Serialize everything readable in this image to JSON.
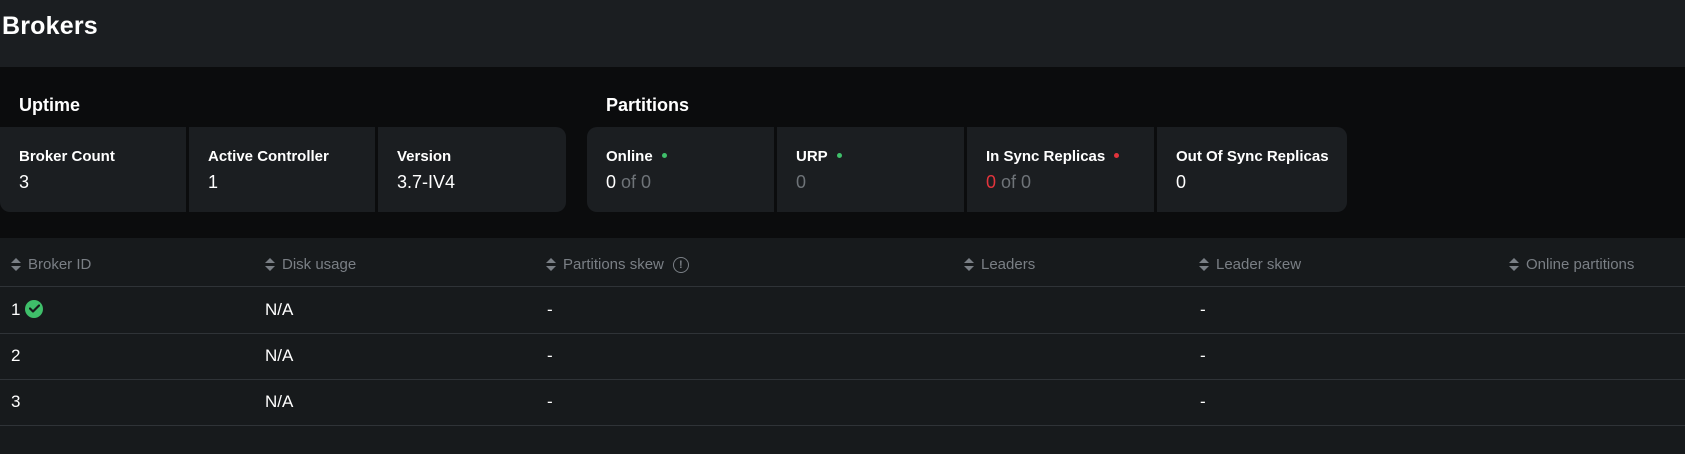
{
  "page": {
    "title": "Brokers"
  },
  "uptime": {
    "title": "Uptime",
    "cards": [
      {
        "label": "Broker Count",
        "value": "3"
      },
      {
        "label": "Active Controller",
        "value": "1"
      },
      {
        "label": "Version",
        "value": "3.7-IV4"
      }
    ]
  },
  "partitions": {
    "title": "Partitions",
    "online": {
      "label": "Online",
      "value": "0",
      "of": "of 0",
      "status_color": "#3fbf6a"
    },
    "urp": {
      "label": "URP",
      "value": "0",
      "status_color": "#3fbf6a"
    },
    "in_sync": {
      "label": "In Sync Replicas",
      "value": "0",
      "of": "of 0",
      "status_color": "#e2343c"
    },
    "out_of_sync": {
      "label": "Out Of Sync Replicas",
      "value": "0"
    }
  },
  "table": {
    "columns": [
      "Broker ID",
      "Disk usage",
      "Partitions skew",
      "Leaders",
      "Leader skew",
      "Online partitions"
    ],
    "partitions_skew_info_icon": "info-icon",
    "rows": [
      {
        "broker_id": "1",
        "is_controller": true,
        "controller_icon": "check-circle-icon",
        "disk_usage": "N/A",
        "partitions_skew": "-",
        "leaders": "",
        "leader_skew": "-",
        "online_partitions": ""
      },
      {
        "broker_id": "2",
        "is_controller": false,
        "disk_usage": "N/A",
        "partitions_skew": "-",
        "leaders": "",
        "leader_skew": "-",
        "online_partitions": ""
      },
      {
        "broker_id": "3",
        "is_controller": false,
        "disk_usage": "N/A",
        "partitions_skew": "-",
        "leaders": "",
        "leader_skew": "-",
        "online_partitions": ""
      }
    ]
  },
  "colors": {
    "accent_green": "#3fbf6a",
    "accent_red": "#e2343c",
    "background": "#171a1c",
    "band": "#0b0c0d",
    "card": "#1b1e21"
  }
}
